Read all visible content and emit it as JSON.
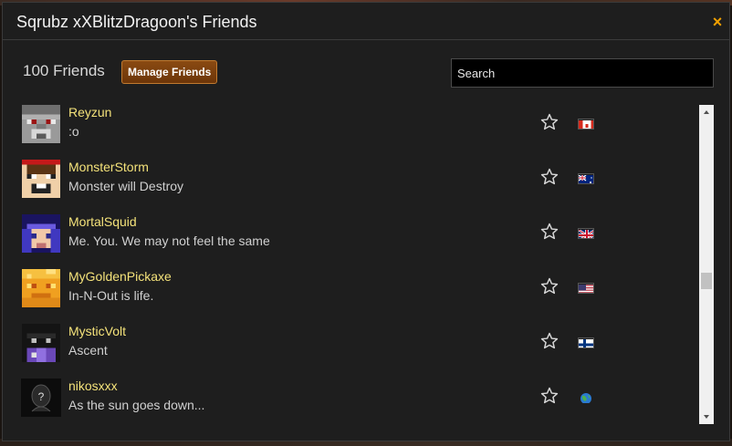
{
  "dialog": {
    "title": "Sqrubz xXBlitzDragoon's Friends",
    "close_glyph": "×"
  },
  "toolbar": {
    "count_label": "100 Friends",
    "manage_label": "Manage Friends",
    "search_placeholder": "Search"
  },
  "friends": [
    {
      "name": "Reyzun",
      "status": ":o",
      "avatar": "reyzun-avatar",
      "flag": "canada-flag"
    },
    {
      "name": "MonsterStorm",
      "status": "Monster will Destroy",
      "avatar": "monsterstorm-avatar",
      "flag": "australia-flag"
    },
    {
      "name": "MortalSquid",
      "status": "Me. You. We may not feel the same",
      "avatar": "mortalsquid-avatar",
      "flag": "uk-flag"
    },
    {
      "name": "MyGoldenPickaxe",
      "status": "In-N-Out is life.",
      "avatar": "mygoldenpickaxe-avatar",
      "flag": "usa-flag"
    },
    {
      "name": "MysticVolt",
      "status": "Ascent",
      "avatar": "mysticvolt-avatar",
      "flag": "finland-flag"
    },
    {
      "name": "nikosxxx",
      "status": "As the sun goes down...",
      "avatar": "nikosxxx-avatar",
      "flag": "globe-icon"
    }
  ],
  "icons": {
    "favorite": "star-outline-icon",
    "scroll_up": "arrow-up-icon",
    "scroll_down": "arrow-down-icon"
  },
  "colors": {
    "name_text": "#f4e27a",
    "close_accent": "#f2a100",
    "button_bg": "#7a3f0e"
  }
}
